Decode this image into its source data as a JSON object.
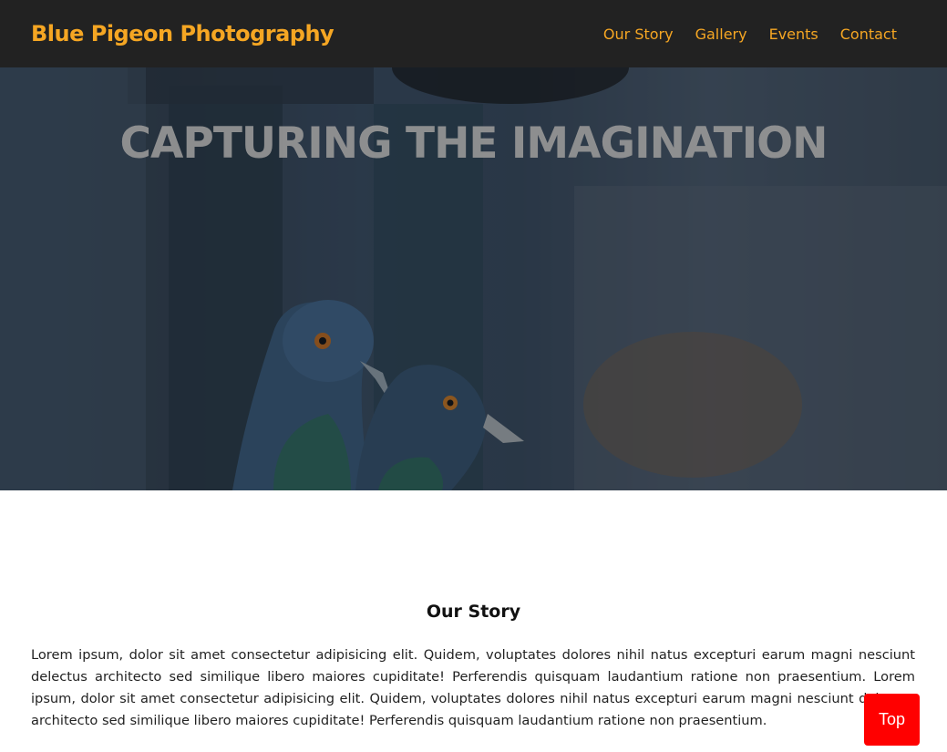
{
  "navbar": {
    "brand": "Blue Pigeon Photography",
    "links": [
      "Our Story",
      "Gallery",
      "Events",
      "Contact"
    ]
  },
  "hero": {
    "title": "CAPTURING THE IMAGINATION",
    "image_alt": "pigeons on a fence"
  },
  "story": {
    "title": "Our Story",
    "text": "Lorem ipsum, dolor sit amet consectetur adipisicing elit. Quidem, voluptates dolores nihil natus excepturi earum magni nesciunt delectus architecto sed similique libero maiores cupiditate! Perferendis quisquam laudantium ratione non praesentium. Lorem ipsum, dolor sit amet consectetur adipisicing elit. Quidem, voluptates dolores nihil natus excepturi earum magni nesciunt delectus architecto sed similique libero maiores cupiditate! Perferendis quisquam laudantium ratione non praesentium."
  },
  "top_button": {
    "label": "Top"
  },
  "colors": {
    "accent": "#f5a623",
    "navbar_bg": "#222222",
    "top_button_bg": "#ff0000"
  }
}
